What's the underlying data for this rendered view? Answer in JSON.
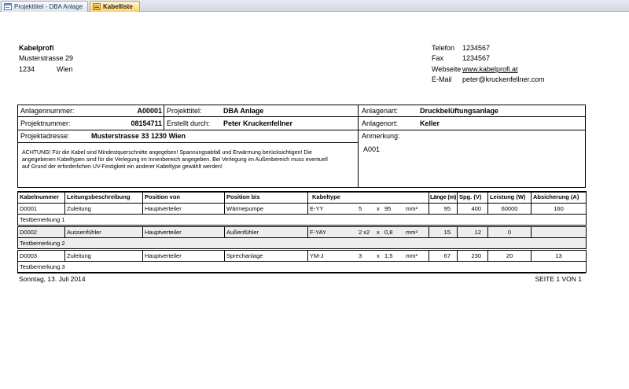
{
  "window": {
    "tabs": [
      {
        "label": "Projekttitel - DBA Anlage",
        "icon": "form-icon",
        "active": false
      },
      {
        "label": "Kabelliste",
        "icon": "report-icon",
        "active": true
      }
    ]
  },
  "company": {
    "name": "Kabelprofi",
    "street": "Musterstrasse 29",
    "zip": "1234",
    "city": "Wien"
  },
  "contact": {
    "phone_label": "Telefon",
    "phone": "1234567",
    "fax_label": "Fax",
    "fax": "1234567",
    "web_label": "Webseite",
    "web": "www.kabelprofi.at",
    "email_label": "E-Mail",
    "email": "peter@kruckenfellner.com"
  },
  "project": {
    "anlagennummer_label": "Anlagennummer:",
    "anlagennummer": "A00001",
    "projekttitel_label": "Projekttitel:",
    "projekttitel": "DBA Anlage",
    "anlagenart_label": "Anlagenart:",
    "anlagenart": "Druckbelüftungsanlage",
    "projektnummer_label": "Projektnummer:",
    "projektnummer": "08154711",
    "erstellt_label": "Erstellt durch:",
    "erstellt": "Peter Kruckenfellner",
    "anlagenort_label": "Anlagenort:",
    "anlagenort": "Keller",
    "projektadresse_label": "Projektadresse:",
    "projektadresse": "Musterstrasse 33 1230 Wien",
    "anmerkung_label": "Anmerkung:",
    "anmerkung": "A001",
    "warning_lines": [
      "ACHTUNG! Für die Kabel sind Mindestquerschnitte angegeben! Spannungsabfall und Erwärmung berücksichtigen! Die",
      "angegebenen Kabeltypen sind für die Verlegung im Innenbereich angegeben. Bei Verlegung im Außenbereich muss eventuell",
      "auf Grund der erforderlichen UV-Festigkeit ein anderer Kabeltype gewählt werden!"
    ]
  },
  "table": {
    "headers": [
      "Kabelnummer",
      "Leitungsbeschreibung",
      "Position von",
      "Position bis",
      "Kabeltype",
      "Länge (m)",
      "Spg. (V)",
      "Leistung (W)",
      "Absicherung (A)"
    ],
    "rows": [
      {
        "kabelnummer": "D0001",
        "beschreibung": "Zuleitung",
        "von": "Hauptverteiler",
        "bis": "Wärmepumpe",
        "type": "E-YY",
        "adern": "5",
        "times": "x",
        "querschnitt": "95",
        "unit": "mm²",
        "laenge": "95",
        "spannung": "400",
        "leistung": "60000",
        "absicherung": "160",
        "bemerkung": "Testbemerkung 1"
      },
      {
        "kabelnummer": "D0002",
        "beschreibung": "Aussenfühler",
        "von": "Hauptverteiler",
        "bis": "Außenfühler",
        "type": "F-YAY",
        "adern": "2 x2",
        "times": "x",
        "querschnitt": "0,8",
        "unit": "mm²",
        "laenge": "15",
        "spannung": "12",
        "leistung": "0",
        "absicherung": "",
        "bemerkung": "Testbemerkung 2"
      },
      {
        "kabelnummer": "D0003",
        "beschreibung": "Zuleitung",
        "von": "Hauptverteiler",
        "bis": "Sprechanlage",
        "type": "YM-J",
        "adern": "3",
        "times": "x",
        "querschnitt": "1,5",
        "unit": "mm²",
        "laenge": "67",
        "spannung": "230",
        "leistung": "20",
        "absicherung": "13",
        "bemerkung": "Testbemerkung 3"
      }
    ]
  },
  "footer": {
    "date": "Sonntag, 13. Juli 2014",
    "page": "SEITE 1 VON 1"
  },
  "colors": {
    "active_tab": "#fcd36b",
    "alternate_row": "#ededed",
    "grid_lines": "#000000"
  }
}
